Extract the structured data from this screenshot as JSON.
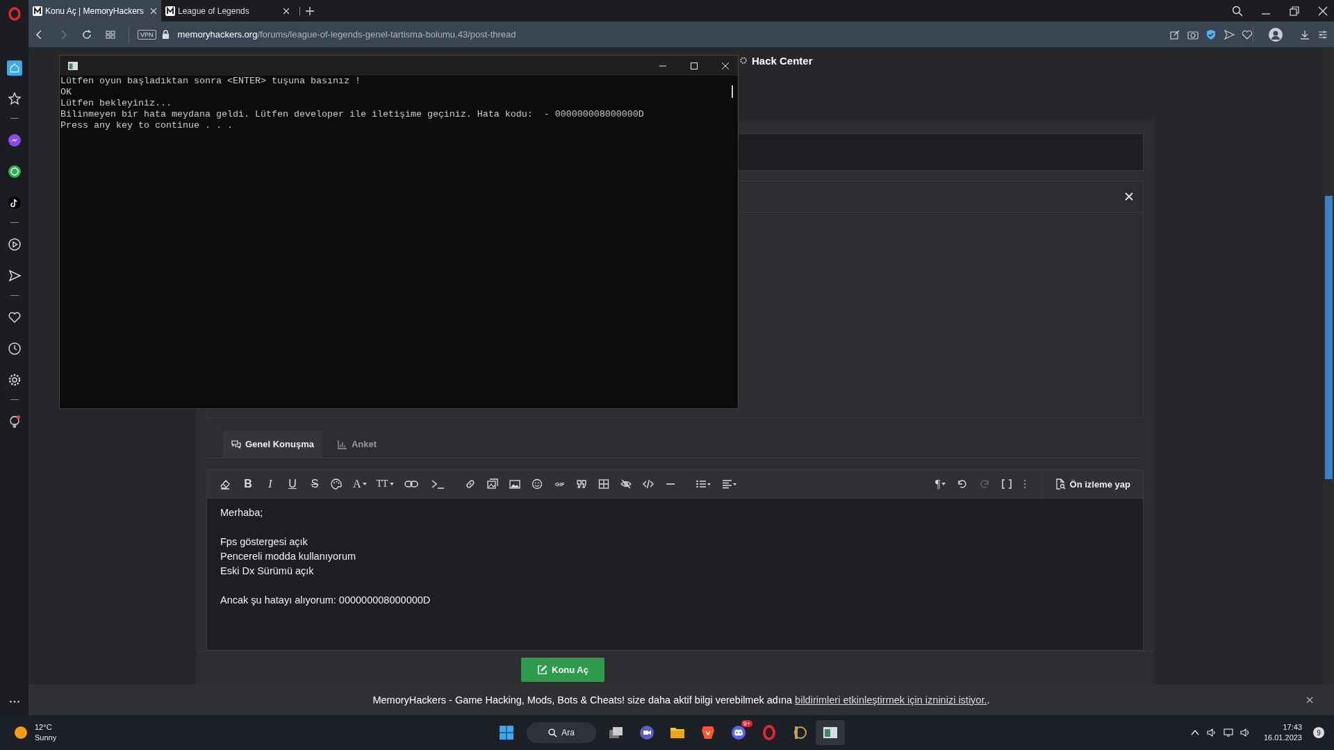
{
  "browser": {
    "tabs": [
      {
        "title": "Konu Aç | MemoryHackers",
        "selected": true
      },
      {
        "title": "League of Legends",
        "selected": false
      }
    ],
    "url_domain": "memoryhackers.org",
    "url_path": "/forums/league-of-legends-genel-tartisma-bolumu.43/post-thread",
    "vpn": "VPN"
  },
  "console": {
    "lines": [
      "Lütfen oyun başladıktan sonra <ENTER> tuşuna basınız !",
      "OK",
      "Lütfen bekleyiniz...",
      "Bilinmeyen bir hata meydana geldi. Lütfen developer ile iletişime geçiniz. Hata kodu:  - 000000008000000D",
      "Press any key to continue . . ."
    ]
  },
  "forum": {
    "site_title": "Hack Center",
    "tabs": [
      {
        "label": "Genel Konuşma",
        "selected": true
      },
      {
        "label": "Anket",
        "selected": false
      }
    ],
    "toolbar_glyphs": [
      "B",
      "I",
      "U",
      "S",
      "A",
      "TT",
      "GIF",
      "¶"
    ],
    "preview_button": "Ön izleme yap",
    "editor_paragraphs": [
      [
        "Merhaba;"
      ],
      [
        "Fps göstergesi açık",
        "Pencereli modda kullanıyorum",
        "Eski Dx Sürümü açık"
      ],
      [
        "Ancak şu hatayı alıyorum: 000000008000000D"
      ]
    ],
    "submit_button": "Konu Aç"
  },
  "notification": {
    "text": "MemoryHackers - Game Hacking, Mods, Bots & Cheats! size daha aktif bilgi verebilmek adına",
    "link": "bildirimleri etkinleştirmek için izninizi istiyor.",
    "suffix": "."
  },
  "taskbar": {
    "temperature": "12°C",
    "weather": "Sunny",
    "search": "Ara",
    "discord_badge": "9+",
    "time": "17:43",
    "date": "16.01.2023",
    "notification_count": "9"
  }
}
